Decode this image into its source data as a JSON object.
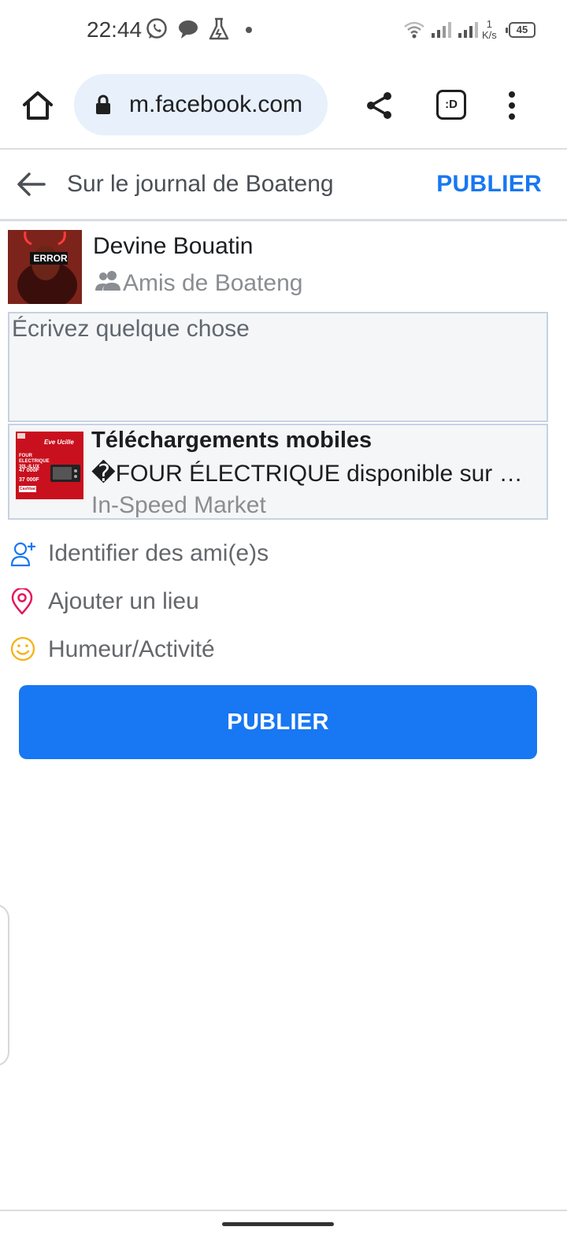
{
  "status_bar": {
    "time": "22:44",
    "network_speed_value": "1",
    "network_speed_unit": "K/s",
    "battery": "45",
    "icons": [
      "whatsapp-icon",
      "chat-bubble-icon",
      "flask-icon",
      "wifi-icon",
      "signal-icon",
      "signal-icon"
    ]
  },
  "browser": {
    "url": "m.facebook.com",
    "tab_label": ":D",
    "icons": [
      "home-icon",
      "lock-icon",
      "share-icon",
      "more-vert-icon"
    ]
  },
  "header": {
    "title": "Sur le journal de Boateng",
    "publish_label": "PUBLIER"
  },
  "author": {
    "name": "Devine Bouatin",
    "avatar_badge": "ERROR",
    "audience": "Amis de Boateng"
  },
  "composer": {
    "placeholder": "Écrivez quelque chose"
  },
  "link_preview": {
    "title": "Téléchargements mobiles",
    "description": "�FOUR ÉLECTRIQUE disponible sur w…",
    "source": "In-Speed Market",
    "thumbnail_text": {
      "brand": "Eve Ucille",
      "product": "FOUR ELECTRIQUE 30L-ILUX",
      "price_old": "47 000F",
      "price_new": "37 000F",
      "cashback": "Cashback 3%"
    }
  },
  "options": [
    {
      "label": "Identifier des ami(e)s",
      "icon": "tag-friend-icon"
    },
    {
      "label": "Ajouter un lieu",
      "icon": "location-pin-icon"
    },
    {
      "label": "Humeur/Activité",
      "icon": "smiley-icon"
    }
  ],
  "publish_button_label": "PUBLIER",
  "colors": {
    "accent": "#1877f2",
    "secondary_text": "#65676b",
    "location_pin": "#e4175d",
    "smiley": "#f5b316"
  }
}
